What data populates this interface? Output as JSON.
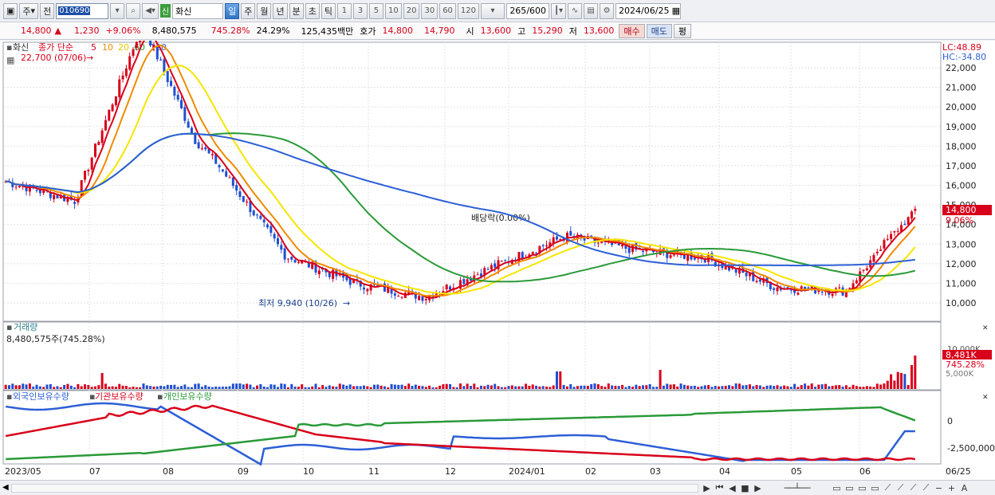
{
  "toolbar": {
    "period_select": "주",
    "prev_label": "전",
    "stock_code": "010690",
    "stock_name": "화신",
    "badge": "신",
    "tabs": [
      "일",
      "주",
      "월",
      "년",
      "분",
      "초",
      "틱"
    ],
    "active_tab": "일",
    "intervals": [
      "1",
      "3",
      "5",
      "10",
      "20",
      "30",
      "60",
      "120"
    ],
    "count": "265",
    "count_total": "/600",
    "date": "2024/06/25"
  },
  "quote": {
    "price": "14,800",
    "change_arrow": "▲",
    "change": "1,230",
    "change_pct": "+9.06%",
    "volume": "8,480,575",
    "volume_ratio": "745.28%",
    "turnover": "24.29%",
    "amount": "125,435백만",
    "bid_label": "호가",
    "ask": "14,800",
    "bid": "14,790",
    "open_label": "시",
    "open": "13,600",
    "high_label": "고",
    "high": "15,290",
    "low_label": "저",
    "low": "13,600",
    "buy_label": "매수",
    "sell_label": "매도",
    "eval_label": "평"
  },
  "price_panel": {
    "legend_name": "화신",
    "legend_ma_label": "종가 단순",
    "ma_periods": [
      "5",
      "10",
      "20",
      "60",
      "120"
    ],
    "ma_colors": [
      "#d8001a",
      "#f08a00",
      "#f5e600",
      "#2a9a38",
      "#2d5fd6"
    ],
    "high_marker": "22,700 (07/06)",
    "low_marker": "최저 9,940 (10/26)",
    "dividend_label": "배당락(0.00%)",
    "lc": "LC:48.89",
    "hc": "HC:-34.80",
    "y_ticks": [
      "22,000",
      "21,000",
      "20,000",
      "19,000",
      "18,000",
      "17,000",
      "16,000",
      "15,000",
      "14,000",
      "13,000",
      "12,000",
      "11,000",
      "10,000"
    ],
    "price_tag": "14,800",
    "pct_tag": "9.06%"
  },
  "volume_panel": {
    "title": "거래량",
    "value": "8,480,575주(745.28%)",
    "tag1": "10,000K",
    "tag2": "8,481K",
    "tag3": "745.28%",
    "tag4": "5,000K"
  },
  "holders_panel": {
    "legend": [
      "외국인보유수량",
      "기관보유수량",
      "개인보유수량"
    ],
    "colors": [
      "#2d5fd6",
      "#d8001a",
      "#2a9a38"
    ],
    "y_ticks": [
      "0",
      "-2,500,000"
    ]
  },
  "x_axis": [
    "2023/05",
    "07",
    "08",
    "09",
    "10",
    "11",
    "12",
    "2024/01",
    "02",
    "03",
    "04",
    "05",
    "06",
    "06/25"
  ],
  "chart_data": {
    "type": "candlestick",
    "period": "daily",
    "y_range": [
      9500,
      22700
    ],
    "close_approx": [
      {
        "month": "2023/05",
        "value": 16200
      },
      {
        "month": "2023/06",
        "value": 15200
      },
      {
        "month": "2023/07",
        "value": 21000
      },
      {
        "month": "2023/08",
        "value": 17200
      },
      {
        "month": "2023/09",
        "value": 12400
      },
      {
        "month": "2023/10",
        "value": 11000
      },
      {
        "month": "2023/11",
        "value": 10300
      },
      {
        "month": "2023/12",
        "value": 11900
      },
      {
        "month": "2024/01",
        "value": 13400
      },
      {
        "month": "2024/02",
        "value": 12700
      },
      {
        "month": "2024/03",
        "value": 12300
      },
      {
        "month": "2024/04",
        "value": 10800
      },
      {
        "month": "2024/05",
        "value": 10600
      },
      {
        "month": "2024/06",
        "value": 14800
      }
    ]
  }
}
